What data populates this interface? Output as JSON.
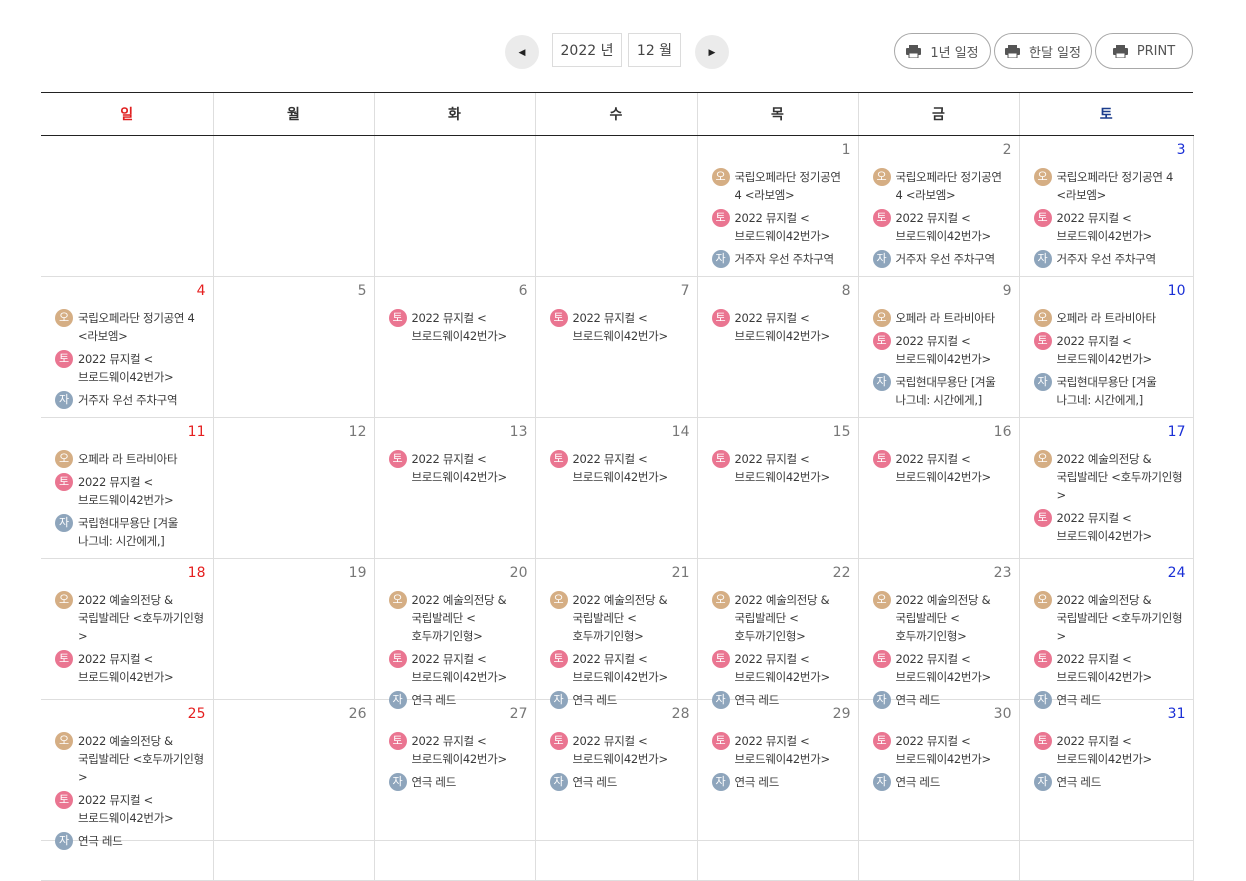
{
  "nav": {
    "prev_glyph": "◀",
    "next_glyph": "▶",
    "year": "2022 년",
    "month": "12 월",
    "year_view_label": "1년 일정",
    "month_view_label": "한달 일정",
    "print_label": "PRINT"
  },
  "colors": {
    "o": "#d5ae84",
    "to": "#ea7591",
    "ja": "#8ea5bc",
    "sunday": "#e51f1f",
    "saturday": "#1a2fd6"
  },
  "weekdays": [
    "일",
    "월",
    "화",
    "수",
    "목",
    "금",
    "토"
  ],
  "weeks": [
    [
      {
        "day": "",
        "events": []
      },
      {
        "day": "",
        "events": []
      },
      {
        "day": "",
        "events": []
      },
      {
        "day": "",
        "events": []
      },
      {
        "day": "1",
        "events": [
          {
            "type": "o",
            "badge": "오",
            "title": "국립오페라단 정기공연 4 <라보엠>"
          },
          {
            "type": "to",
            "badge": "토",
            "title": "2022 뮤지컬 <브로드웨이42번가>"
          },
          {
            "type": "ja",
            "badge": "자",
            "title": "거주자 우선 주차구역"
          }
        ]
      },
      {
        "day": "2",
        "events": [
          {
            "type": "o",
            "badge": "오",
            "title": "국립오페라단 정기공연 4 <라보엠>"
          },
          {
            "type": "to",
            "badge": "토",
            "title": "2022 뮤지컬 <브로드웨이42번가>"
          },
          {
            "type": "ja",
            "badge": "자",
            "title": "거주자 우선 주차구역"
          }
        ]
      },
      {
        "day": "3",
        "events": [
          {
            "type": "o",
            "badge": "오",
            "title": "국립오페라단 정기공연 4 <라보엠>"
          },
          {
            "type": "to",
            "badge": "토",
            "title": "2022 뮤지컬 <브로드웨이42번가>"
          },
          {
            "type": "ja",
            "badge": "자",
            "title": "거주자 우선 주차구역"
          }
        ]
      }
    ],
    [
      {
        "day": "4",
        "events": [
          {
            "type": "o",
            "badge": "오",
            "title": "국립오페라단 정기공연 4 <라보엠>"
          },
          {
            "type": "to",
            "badge": "토",
            "title": "2022 뮤지컬 <브로드웨이42번가>"
          },
          {
            "type": "ja",
            "badge": "자",
            "title": "거주자 우선 주차구역"
          }
        ]
      },
      {
        "day": "5",
        "events": []
      },
      {
        "day": "6",
        "events": [
          {
            "type": "to",
            "badge": "토",
            "title": "2022 뮤지컬 <브로드웨이42번가>"
          }
        ]
      },
      {
        "day": "7",
        "events": [
          {
            "type": "to",
            "badge": "토",
            "title": "2022 뮤지컬 <브로드웨이42번가>"
          }
        ]
      },
      {
        "day": "8",
        "events": [
          {
            "type": "to",
            "badge": "토",
            "title": "2022 뮤지컬 <브로드웨이42번가>"
          }
        ]
      },
      {
        "day": "9",
        "events": [
          {
            "type": "o",
            "badge": "오",
            "title": "오페라 라 트라비아타"
          },
          {
            "type": "to",
            "badge": "토",
            "title": "2022 뮤지컬 <브로드웨이42번가>"
          },
          {
            "type": "ja",
            "badge": "자",
            "title": "국립현대무용단 [겨울 나그네: 시간에게,]"
          }
        ]
      },
      {
        "day": "10",
        "events": [
          {
            "type": "o",
            "badge": "오",
            "title": "오페라 라 트라비아타"
          },
          {
            "type": "to",
            "badge": "토",
            "title": "2022 뮤지컬 <브로드웨이42번가>"
          },
          {
            "type": "ja",
            "badge": "자",
            "title": "국립현대무용단 [겨울 나그네: 시간에게,]"
          }
        ]
      }
    ],
    [
      {
        "day": "11",
        "events": [
          {
            "type": "o",
            "badge": "오",
            "title": "오페라 라 트라비아타"
          },
          {
            "type": "to",
            "badge": "토",
            "title": "2022 뮤지컬 <브로드웨이42번가>"
          },
          {
            "type": "ja",
            "badge": "자",
            "title": "국립현대무용단 [겨울 나그네: 시간에게,]"
          }
        ]
      },
      {
        "day": "12",
        "events": []
      },
      {
        "day": "13",
        "events": [
          {
            "type": "to",
            "badge": "토",
            "title": "2022 뮤지컬 <브로드웨이42번가>"
          }
        ]
      },
      {
        "day": "14",
        "events": [
          {
            "type": "to",
            "badge": "토",
            "title": "2022 뮤지컬 <브로드웨이42번가>"
          }
        ]
      },
      {
        "day": "15",
        "events": [
          {
            "type": "to",
            "badge": "토",
            "title": "2022 뮤지컬 <브로드웨이42번가>"
          }
        ]
      },
      {
        "day": "16",
        "events": [
          {
            "type": "to",
            "badge": "토",
            "title": "2022 뮤지컬 <브로드웨이42번가>"
          }
        ]
      },
      {
        "day": "17",
        "events": [
          {
            "type": "o",
            "badge": "오",
            "title": "2022 예술의전당 & 국립발레단 <호두까기인형>"
          },
          {
            "type": "to",
            "badge": "토",
            "title": "2022 뮤지컬 <브로드웨이42번가>"
          }
        ]
      }
    ],
    [
      {
        "day": "18",
        "events": [
          {
            "type": "o",
            "badge": "오",
            "title": "2022 예술의전당 & 국립발레단 <호두까기인형>"
          },
          {
            "type": "to",
            "badge": "토",
            "title": "2022 뮤지컬 <브로드웨이42번가>"
          }
        ]
      },
      {
        "day": "19",
        "events": []
      },
      {
        "day": "20",
        "events": [
          {
            "type": "o",
            "badge": "오",
            "title": "2022 예술의전당 & 국립발레단 <호두까기인형>"
          },
          {
            "type": "to",
            "badge": "토",
            "title": "2022 뮤지컬 <브로드웨이42번가>"
          },
          {
            "type": "ja",
            "badge": "자",
            "title": "연극 레드"
          }
        ]
      },
      {
        "day": "21",
        "events": [
          {
            "type": "o",
            "badge": "오",
            "title": "2022 예술의전당 & 국립발레단 <호두까기인형>"
          },
          {
            "type": "to",
            "badge": "토",
            "title": "2022 뮤지컬 <브로드웨이42번가>"
          },
          {
            "type": "ja",
            "badge": "자",
            "title": "연극 레드"
          }
        ]
      },
      {
        "day": "22",
        "events": [
          {
            "type": "o",
            "badge": "오",
            "title": "2022 예술의전당 & 국립발레단 <호두까기인형>"
          },
          {
            "type": "to",
            "badge": "토",
            "title": "2022 뮤지컬 <브로드웨이42번가>"
          },
          {
            "type": "ja",
            "badge": "자",
            "title": "연극 레드"
          }
        ]
      },
      {
        "day": "23",
        "events": [
          {
            "type": "o",
            "badge": "오",
            "title": "2022 예술의전당 & 국립발레단 <호두까기인형>"
          },
          {
            "type": "to",
            "badge": "토",
            "title": "2022 뮤지컬 <브로드웨이42번가>"
          },
          {
            "type": "ja",
            "badge": "자",
            "title": "연극 레드"
          }
        ]
      },
      {
        "day": "24",
        "events": [
          {
            "type": "o",
            "badge": "오",
            "title": "2022 예술의전당 & 국립발레단 <호두까기인형>"
          },
          {
            "type": "to",
            "badge": "토",
            "title": "2022 뮤지컬 <브로드웨이42번가>"
          },
          {
            "type": "ja",
            "badge": "자",
            "title": "연극 레드"
          }
        ]
      }
    ],
    [
      {
        "day": "25",
        "events": [
          {
            "type": "o",
            "badge": "오",
            "title": "2022 예술의전당 & 국립발레단 <호두까기인형>"
          },
          {
            "type": "to",
            "badge": "토",
            "title": "2022 뮤지컬 <브로드웨이42번가>"
          },
          {
            "type": "ja",
            "badge": "자",
            "title": "연극 레드"
          }
        ]
      },
      {
        "day": "26",
        "events": []
      },
      {
        "day": "27",
        "events": [
          {
            "type": "to",
            "badge": "토",
            "title": "2022 뮤지컬 <브로드웨이42번가>"
          },
          {
            "type": "ja",
            "badge": "자",
            "title": "연극 레드"
          }
        ]
      },
      {
        "day": "28",
        "events": [
          {
            "type": "to",
            "badge": "토",
            "title": "2022 뮤지컬 <브로드웨이42번가>"
          },
          {
            "type": "ja",
            "badge": "자",
            "title": "연극 레드"
          }
        ]
      },
      {
        "day": "29",
        "events": [
          {
            "type": "to",
            "badge": "토",
            "title": "2022 뮤지컬 <브로드웨이42번가>"
          },
          {
            "type": "ja",
            "badge": "자",
            "title": "연극 레드"
          }
        ]
      },
      {
        "day": "30",
        "events": [
          {
            "type": "to",
            "badge": "토",
            "title": "2022 뮤지컬 <브로드웨이42번가>"
          },
          {
            "type": "ja",
            "badge": "자",
            "title": "연극 레드"
          }
        ]
      },
      {
        "day": "31",
        "events": [
          {
            "type": "to",
            "badge": "토",
            "title": "2022 뮤지컬 <브로드웨이42번가>"
          },
          {
            "type": "ja",
            "badge": "자",
            "title": "연극 레드"
          }
        ]
      }
    ]
  ]
}
